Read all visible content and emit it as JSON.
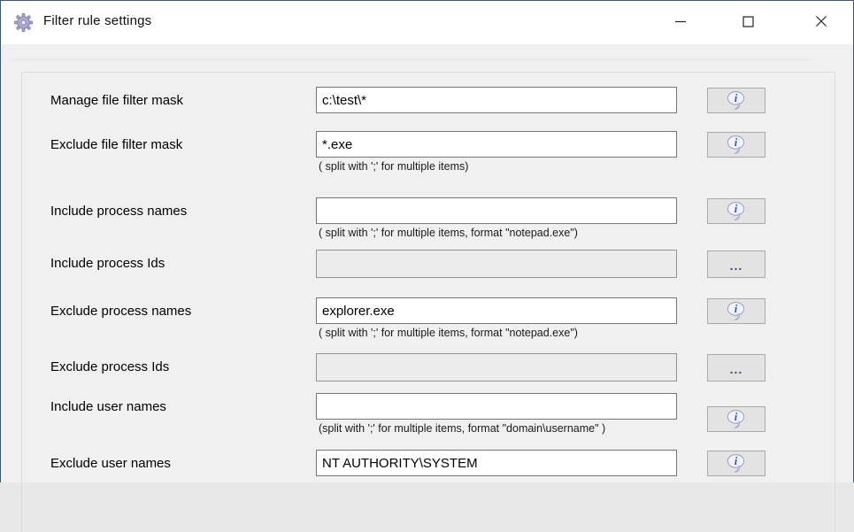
{
  "window": {
    "title": "Filter rule settings",
    "icon": "gear-icon"
  },
  "colors": {
    "titlebar_bg": "#ffffff",
    "client_bg": "#f0f0f0",
    "input_border": "#767676",
    "button_bg": "#e3e3e3",
    "info_icon_blue": "#1d5bd8",
    "window_border": "#3e556d"
  },
  "form": {
    "browse_label": "...",
    "rows": [
      {
        "label": "Manage file filter mask",
        "value": "c:\\test\\*",
        "button": "info",
        "disabled": false,
        "hint": ""
      },
      {
        "label": "Exclude file filter mask",
        "value": "*.exe",
        "button": "info",
        "disabled": false,
        "hint": "( split with ';' for multiple items)"
      },
      {
        "label": "Include process names",
        "value": "",
        "button": "info",
        "disabled": false,
        "hint": "( split with ';' for multiple items, format \"notepad.exe\")"
      },
      {
        "label": "Include process Ids",
        "value": "",
        "button": "browse",
        "disabled": true,
        "hint": ""
      },
      {
        "label": "Exclude process names",
        "value": "explorer.exe",
        "button": "info",
        "disabled": false,
        "hint": "( split with ';' for multiple items, format \"notepad.exe\")"
      },
      {
        "label": "Exclude process Ids",
        "value": "",
        "button": "browse",
        "disabled": true,
        "hint": ""
      },
      {
        "label": "Include user names",
        "value": "",
        "button": "info",
        "disabled": false,
        "hint": "(split with ';' for multiple items, format \"domain\\username\" )"
      },
      {
        "label": "Exclude user names",
        "value": "NT AUTHORITY\\SYSTEM",
        "button": "info",
        "disabled": false,
        "hint": ""
      }
    ]
  }
}
